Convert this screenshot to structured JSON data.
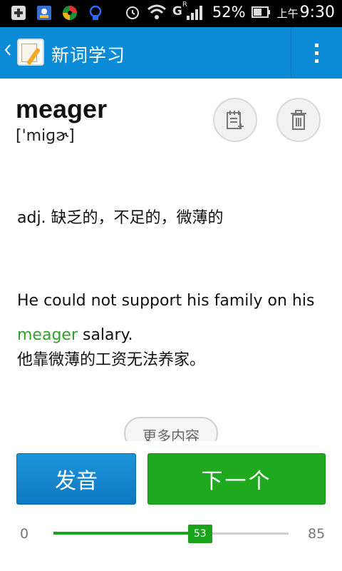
{
  "status_bar": {
    "battery": "52%",
    "time_prefix": "上午",
    "time": "9:30",
    "network_label": "G",
    "roaming_label": "R"
  },
  "action_bar": {
    "back_icon": "chevron-left-icon",
    "app_icon": "notepad-pen-icon",
    "title": "新词学习",
    "menu_icon": "overflow-menu-icon"
  },
  "word": {
    "headword": "meager",
    "phonetic": "['miɡɚ]",
    "add_note_icon": "note-add-icon",
    "delete_icon": "trash-icon"
  },
  "definition": "adj. 缺乏的，不足的，微薄的",
  "example": {
    "en_before": "He could not support his family on his ",
    "en_highlight": "meager",
    "en_after": " salary.",
    "zh": "他靠微薄的工资无法养家。",
    "highlight_color": "#33a02c"
  },
  "buttons": {
    "more": "更多内容",
    "pronounce": "发音",
    "next": "下一个"
  },
  "progress": {
    "min": "0",
    "max": "85",
    "value": "53",
    "value_num": 53,
    "max_num": 85
  },
  "colors": {
    "accent_blue": "#0b8bd5",
    "accent_green": "#1fa91f"
  }
}
